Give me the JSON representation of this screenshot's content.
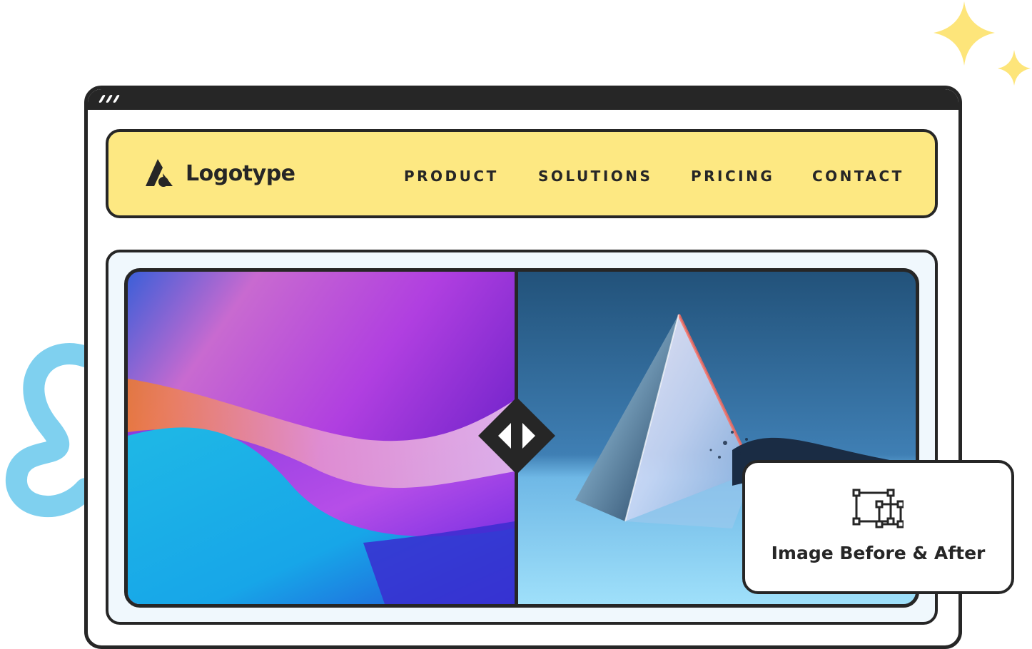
{
  "brand": {
    "name": "Logotype",
    "logo_icon": "mountain-logo-icon"
  },
  "nav": {
    "items": [
      {
        "label": "PRODUCT"
      },
      {
        "label": "SOLUTIONS"
      },
      {
        "label": "PRICING"
      },
      {
        "label": "CONTACT"
      }
    ]
  },
  "comparison": {
    "before_image": "abstract-purple-blue-waves",
    "after_image": "glass-prism-pyramid",
    "handle_icon": "compare-arrows-icon"
  },
  "card": {
    "icon": "image-frame-icon",
    "label": "Image Before & After"
  },
  "colors": {
    "navbar": "#fde882",
    "outline": "#262626",
    "panel": "#f0f8fd",
    "accent_squiggle": "#7fd0ef",
    "sparkle": "#fde57a"
  }
}
